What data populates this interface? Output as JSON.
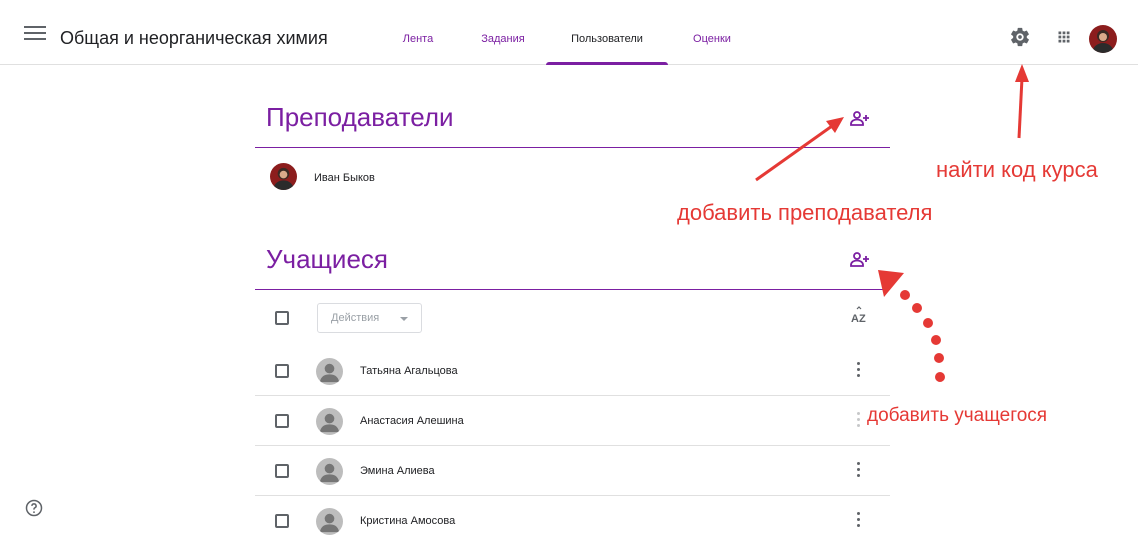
{
  "header": {
    "course_title": "Общая и неорганическая химия",
    "tabs": [
      {
        "label": "Лента"
      },
      {
        "label": "Задания"
      },
      {
        "label": "Пользователи",
        "active": true
      },
      {
        "label": "Оценки"
      }
    ]
  },
  "teachers": {
    "title": "Преподаватели",
    "items": [
      {
        "name": "Иван Быков"
      }
    ]
  },
  "students": {
    "title": "Учащиеся",
    "actions_label": "Действия",
    "sort_icon_text": "AZ",
    "items": [
      {
        "name": "Татьяна Агальцова"
      },
      {
        "name": "Анастасия Алешина"
      },
      {
        "name": "Эмина Алиева"
      },
      {
        "name": "Кристина Амосова"
      }
    ]
  },
  "annotations": {
    "course_code": "найти код курса",
    "add_teacher": "добавить преподавателя",
    "add_student": "добавить учащегося"
  },
  "colors": {
    "accent": "#7b1fa2",
    "annotation": "#e53935",
    "icon": "#5f6368",
    "divider": "#e0e0e0"
  },
  "icons": [
    "menu-icon",
    "gear-icon",
    "apps-grid-icon",
    "add-person-icon",
    "sort-az-icon",
    "more-vertical-icon",
    "help-icon",
    "person-icon"
  ]
}
